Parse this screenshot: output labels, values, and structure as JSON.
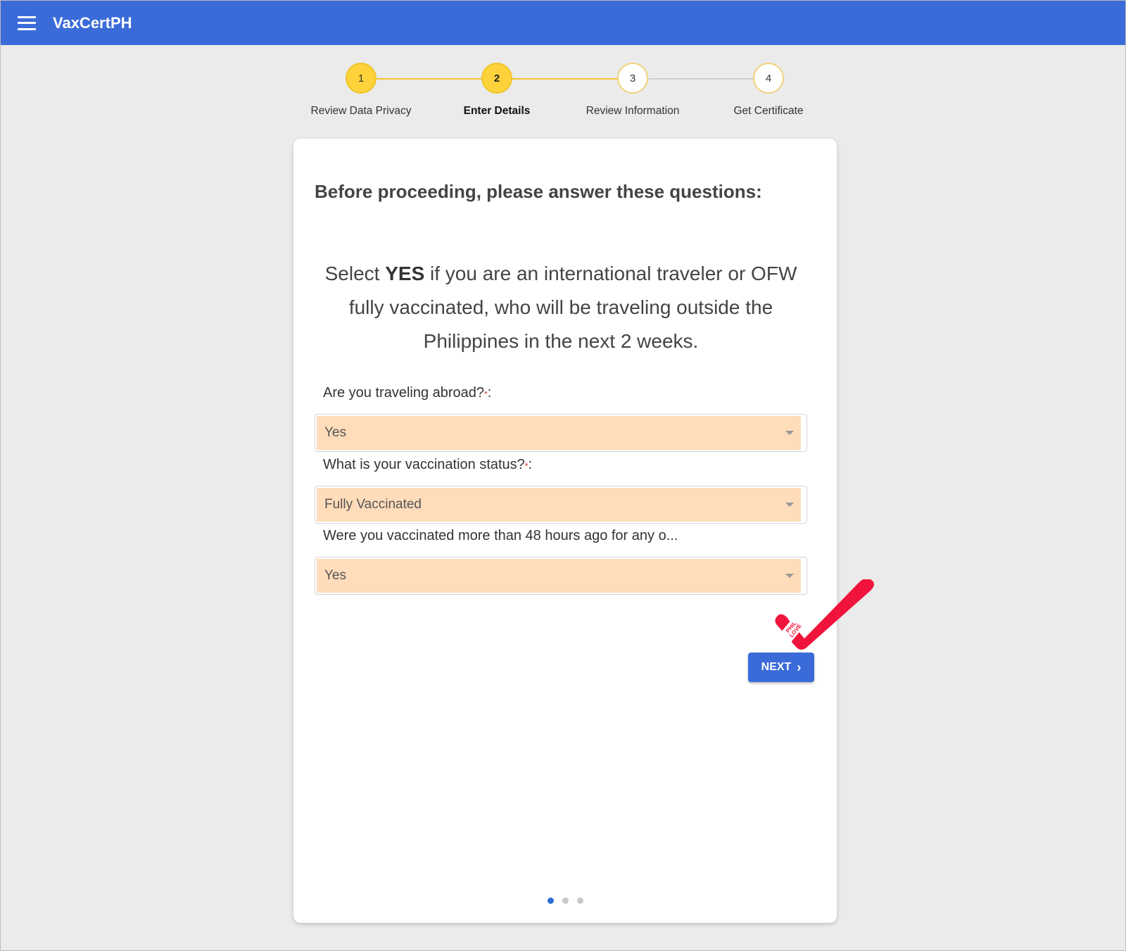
{
  "header": {
    "title": "VaxCertPH",
    "menu_icon": "hamburger-menu-icon"
  },
  "stepper": {
    "steps": [
      {
        "number": "1",
        "label": "Review Data Privacy",
        "state": "done"
      },
      {
        "number": "2",
        "label": "Enter Details",
        "state": "active"
      },
      {
        "number": "3",
        "label": "Review Information",
        "state": "pending"
      },
      {
        "number": "4",
        "label": "Get Certificate",
        "state": "pending"
      }
    ]
  },
  "card": {
    "heading": "Before proceeding, please answer these questions:",
    "instruction": {
      "prefix": "Select ",
      "emphasis": "YES",
      "suffix": " if you are an international traveler or OFW fully vaccinated, who will be traveling outside the Philippines in the next 2 weeks."
    },
    "questions": [
      {
        "label": "Are you traveling abroad?",
        "required_mark": "*",
        "suffix": ":",
        "value": "Yes"
      },
      {
        "label": "What is your vaccination status?",
        "required_mark": "*",
        "suffix": ":",
        "value": "Fully Vaccinated"
      },
      {
        "label": "Were you vaccinated more than 48 hours ago for any o...",
        "required_mark": "",
        "suffix": "",
        "value": "Yes"
      }
    ],
    "next_button": {
      "label": "NEXT",
      "icon": "chevron-right-icon"
    },
    "pagination": {
      "total": 3,
      "current": 1
    }
  },
  "sticker": {
    "text": "PHIL.LOVE",
    "color": "#f0143c",
    "icon": "checkmark-icon"
  },
  "colors": {
    "appbar": "#3a6bd8",
    "step_active": "#fdd23a",
    "select_fill": "#ffdcba",
    "button": "#3a6bd8",
    "page_background": "#ebebeb"
  }
}
